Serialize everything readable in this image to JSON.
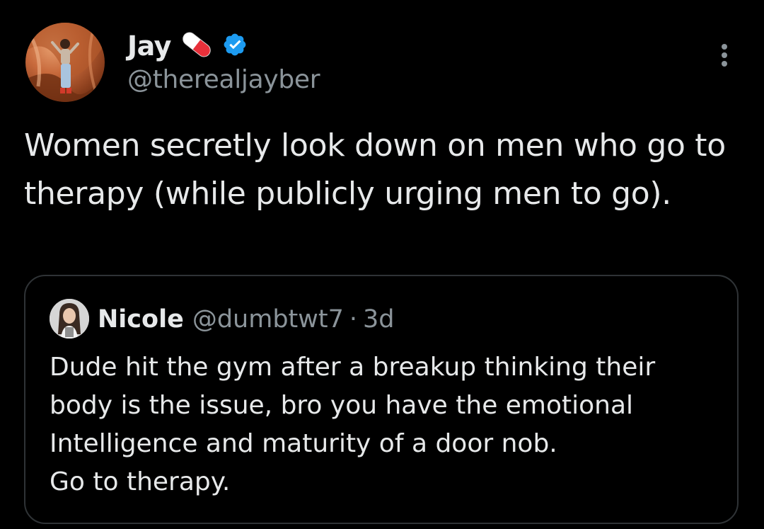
{
  "tweet": {
    "author": {
      "name": "Jay",
      "handle": "@therealjayber",
      "emoji_icon": "pill-icon",
      "verified_icon": "verified-badge-icon"
    },
    "menu_icon": "more-vertical-icon",
    "text": "Women secretly look down on men who go to therapy (while publicly urging men to go)."
  },
  "quoted_tweet": {
    "author": {
      "name": "Nicole",
      "handle": "@dumbtwt7"
    },
    "separator": "·",
    "time": "3d",
    "text": "Dude hit the gym after a breakup thinking their body is the issue, bro you have the emotional Intelligence and maturity of a door nob.\nGo to therapy."
  },
  "colors": {
    "background": "#000000",
    "text": "#e7e9ea",
    "secondary_text": "#8b949a",
    "border": "#2f3336",
    "verified": "#1d9bf0",
    "pill_red": "#e8303a"
  }
}
